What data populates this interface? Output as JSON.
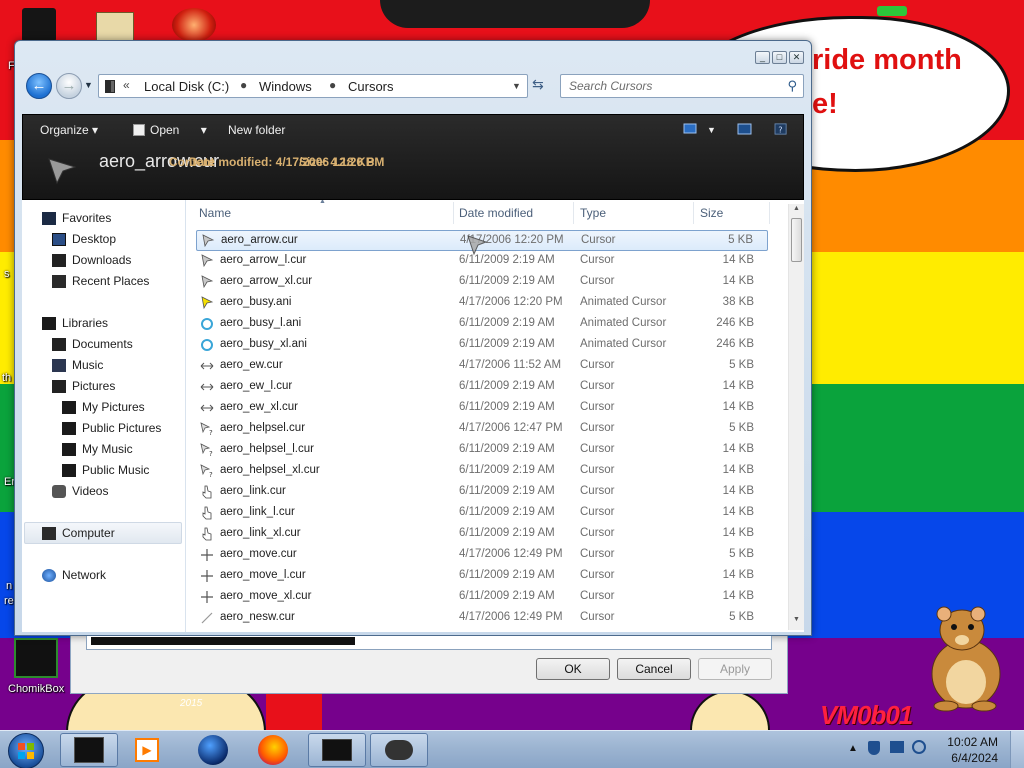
{
  "desktop": {
    "banner_line1": "ride month",
    "banner_line2": "e!",
    "year_watermark": "2015",
    "signature": "VM0b01",
    "icons": [
      {
        "label": "ChomikBox"
      }
    ],
    "edge_fragments": [
      "F",
      "s",
      "th",
      "Er",
      "n",
      "re"
    ]
  },
  "dialog": {
    "window_controls": [
      "_",
      "□",
      "✕"
    ],
    "address": {
      "prefix": "«",
      "segments": [
        "Local Disk (C:)",
        "Windows",
        "Cursors"
      ]
    },
    "search_placeholder": "Search Cursors",
    "commands": {
      "organize": "Organize",
      "open": "Open",
      "new_folder": "New folder"
    },
    "preview": {
      "file_name": "aero_arrow.cur",
      "meta_1": "Content",
      "meta_2": "Date modified: 4/17/2006 12:20 PM",
      "meta_3": "Size: 4.18 KB"
    },
    "nav": {
      "favorites": "Favorites",
      "desktop": "Desktop",
      "downloads": "Downloads",
      "recent_places": "Recent Places",
      "libraries": "Libraries",
      "documents": "Documents",
      "music": "Music",
      "pictures": "Pictures",
      "my_pictures": "My Pictures",
      "public_pictures": "Public Pictures",
      "my_music": "My Music",
      "public_music": "Public Music",
      "videos": "Videos",
      "computer": "Computer",
      "network": "Network"
    },
    "columns": {
      "name": "Name",
      "date": "Date modified",
      "type": "Type",
      "size": "Size"
    },
    "files": [
      {
        "name": "aero_arrow.cur",
        "date": "4/17/2006 12:20 PM",
        "type": "Cursor",
        "size": "5 KB",
        "icon": "arrow-cursor-icon"
      },
      {
        "name": "aero_arrow_l.cur",
        "date": "6/11/2009 2:19 AM",
        "type": "Cursor",
        "size": "14 KB",
        "icon": "arrow-cursor-icon"
      },
      {
        "name": "aero_arrow_xl.cur",
        "date": "6/11/2009 2:19 AM",
        "type": "Cursor",
        "size": "14 KB",
        "icon": "arrow-cursor-icon"
      },
      {
        "name": "aero_busy.ani",
        "date": "4/17/2006 12:20 PM",
        "type": "Animated Cursor",
        "size": "38 KB",
        "icon": "busy-cursor-icon"
      },
      {
        "name": "aero_busy_l.ani",
        "date": "6/11/2009 2:19 AM",
        "type": "Animated Cursor",
        "size": "246 KB",
        "icon": "busy-ring-icon"
      },
      {
        "name": "aero_busy_xl.ani",
        "date": "6/11/2009 2:19 AM",
        "type": "Animated Cursor",
        "size": "246 KB",
        "icon": "busy-ring-icon"
      },
      {
        "name": "aero_ew.cur",
        "date": "4/17/2006 11:52 AM",
        "type": "Cursor",
        "size": "5 KB",
        "icon": "resize-ew-icon"
      },
      {
        "name": "aero_ew_l.cur",
        "date": "6/11/2009 2:19 AM",
        "type": "Cursor",
        "size": "14 KB",
        "icon": "resize-ew-icon"
      },
      {
        "name": "aero_ew_xl.cur",
        "date": "6/11/2009 2:19 AM",
        "type": "Cursor",
        "size": "14 KB",
        "icon": "resize-ew-icon"
      },
      {
        "name": "aero_helpsel.cur",
        "date": "4/17/2006 12:47 PM",
        "type": "Cursor",
        "size": "5 KB",
        "icon": "help-cursor-icon"
      },
      {
        "name": "aero_helpsel_l.cur",
        "date": "6/11/2009 2:19 AM",
        "type": "Cursor",
        "size": "14 KB",
        "icon": "help-cursor-icon"
      },
      {
        "name": "aero_helpsel_xl.cur",
        "date": "6/11/2009 2:19 AM",
        "type": "Cursor",
        "size": "14 KB",
        "icon": "help-cursor-icon"
      },
      {
        "name": "aero_link.cur",
        "date": "6/11/2009 2:19 AM",
        "type": "Cursor",
        "size": "14 KB",
        "icon": "hand-cursor-icon"
      },
      {
        "name": "aero_link_l.cur",
        "date": "6/11/2009 2:19 AM",
        "type": "Cursor",
        "size": "14 KB",
        "icon": "hand-cursor-icon"
      },
      {
        "name": "aero_link_xl.cur",
        "date": "6/11/2009 2:19 AM",
        "type": "Cursor",
        "size": "14 KB",
        "icon": "hand-cursor-icon"
      },
      {
        "name": "aero_move.cur",
        "date": "4/17/2006 12:49 PM",
        "type": "Cursor",
        "size": "5 KB",
        "icon": "move-cursor-icon"
      },
      {
        "name": "aero_move_l.cur",
        "date": "6/11/2009 2:19 AM",
        "type": "Cursor",
        "size": "14 KB",
        "icon": "move-cursor-icon"
      },
      {
        "name": "aero_move_xl.cur",
        "date": "6/11/2009 2:19 AM",
        "type": "Cursor",
        "size": "14 KB",
        "icon": "move-cursor-icon"
      },
      {
        "name": "aero_nesw.cur",
        "date": "4/17/2006 12:49 PM",
        "type": "Cursor",
        "size": "5 KB",
        "icon": "resize-nesw-icon"
      }
    ],
    "buttons": {
      "ok": "OK",
      "cancel": "Cancel",
      "apply": "Apply"
    }
  },
  "taskbar": {
    "time": "10:02 AM",
    "date": "6/4/2024",
    "pinned": [
      "start-orb",
      "folder-app",
      "media-player",
      "app-globe",
      "firefox",
      "monitor-app",
      "mouse-app"
    ]
  },
  "colors": {
    "selection_bg": "#dcebfb",
    "selection_border": "#7da2ce",
    "command_bar": "#1c1c1c",
    "banner_text": "#e01010"
  }
}
